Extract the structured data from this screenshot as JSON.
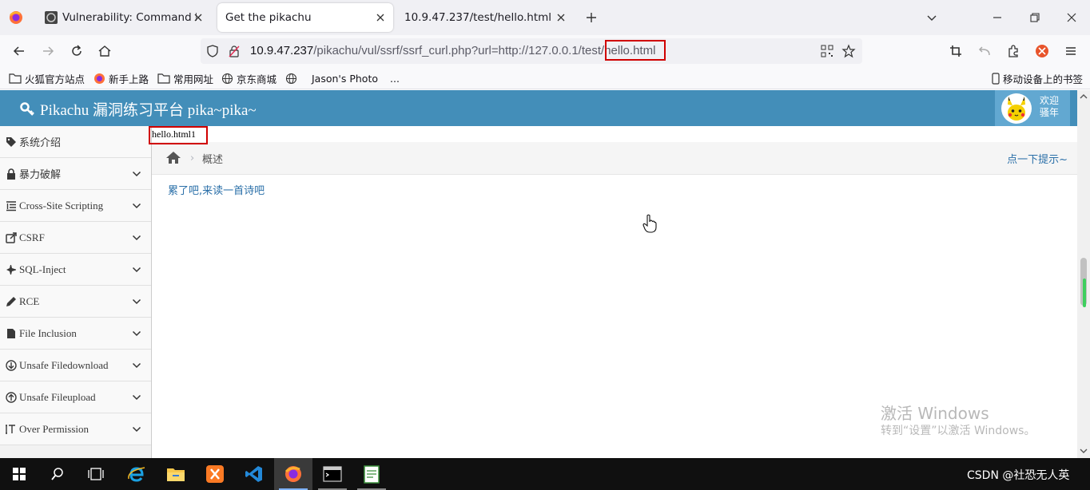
{
  "browser": {
    "tabs": [
      {
        "title": "Vulnerability: Command Inje",
        "active": false
      },
      {
        "title": "Get the pikachu",
        "active": true
      },
      {
        "title": "10.9.47.237/test/hello.html",
        "active": false
      }
    ],
    "url": {
      "host": "10.9.47.237",
      "path": "/pikachu/vul/ssrf/ssrf_curl.php?url=http://127.0.0.1/test/",
      "highlighted": "hello.html"
    },
    "bookmarks": [
      "火狐官方站点",
      "新手上路",
      "常用网址",
      "京东商城",
      "Jason's Photo",
      "...",
      "移动设备上的书签"
    ]
  },
  "site": {
    "title": "Pikachu 漏洞练习平台 pika~pika~",
    "welcome_line1": "欢迎",
    "welcome_line2": "骚年"
  },
  "sidebar": {
    "items": [
      {
        "label": "系统介绍",
        "icon": "tag-icon",
        "expandable": false
      },
      {
        "label": "暴力破解",
        "icon": "lock-icon",
        "expandable": true
      },
      {
        "label": "Cross-Site Scripting",
        "icon": "list-icon",
        "expandable": true
      },
      {
        "label": "CSRF",
        "icon": "share-icon",
        "expandable": true
      },
      {
        "label": "SQL-Inject",
        "icon": "fighter-jet-icon",
        "expandable": true
      },
      {
        "label": "RCE",
        "icon": "pencil-icon",
        "expandable": true
      },
      {
        "label": "File Inclusion",
        "icon": "file-icon",
        "expandable": true
      },
      {
        "label": "Unsafe Filedownload",
        "icon": "download-icon",
        "expandable": true
      },
      {
        "label": "Unsafe Fileupload",
        "icon": "upload-icon",
        "expandable": true
      },
      {
        "label": "Over Permission",
        "icon": "text-height-icon",
        "expandable": true
      }
    ]
  },
  "main": {
    "echo_output": "hello.html1",
    "breadcrumb_current": "概述",
    "breadcrumb_sep": "›",
    "hint_link": "点一下提示~",
    "poem_link": "累了吧,来读一首诗吧"
  },
  "watermark": {
    "line1": "激活 Windows",
    "line2": "转到“设置”以激活 Windows。"
  },
  "taskbar": {
    "tray_text": "CSDN @社恐无人英",
    "apps": [
      "start-icon",
      "search-icon",
      "task-view-icon",
      "ie-icon",
      "file-explorer-icon",
      "xampp-icon",
      "vscode-icon",
      "firefox-icon",
      "terminal-icon",
      "notepad-icon"
    ]
  },
  "colors": {
    "header": "#438eb9",
    "user_box": "#62a8d1",
    "link": "#2a6fa8",
    "highlight_box": "#d00000"
  }
}
